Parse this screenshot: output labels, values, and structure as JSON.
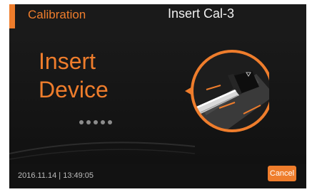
{
  "header": {
    "title": "Calibration",
    "step": "Insert Cal-3"
  },
  "main": {
    "heading_line1": "Insert",
    "heading_line2": "Device",
    "progress_dots": 5
  },
  "footer": {
    "datetime": "2016.11.14 | 13:49:05",
    "cancel_label": "Cancel"
  },
  "colors": {
    "accent": "#ef7d2c",
    "background": "#161616",
    "text_primary": "#f0f0f0",
    "text_muted": "#bdbdbd"
  },
  "icons": [
    "device-insert-illustration",
    "progress-dots"
  ]
}
